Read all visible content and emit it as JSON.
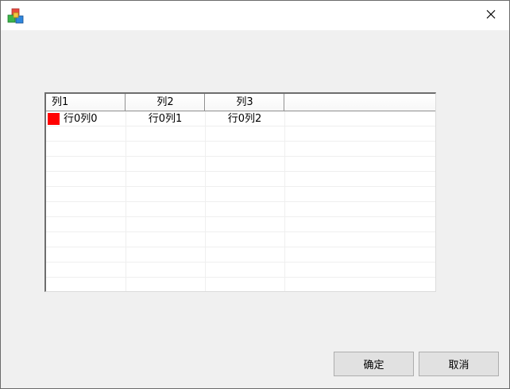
{
  "window": {
    "app_icon": "app-cubes-icon",
    "close_icon": "close-icon"
  },
  "table": {
    "columns": [
      "列1",
      "列2",
      "列3",
      ""
    ],
    "rows": [
      {
        "icon": "red-square-icon",
        "icon_color": "#ff0000",
        "cells": [
          "行0列0",
          "行0列1",
          "行0列2"
        ]
      }
    ],
    "empty_row_count": 11
  },
  "buttons": {
    "ok_label": "确定",
    "cancel_label": "取消"
  }
}
